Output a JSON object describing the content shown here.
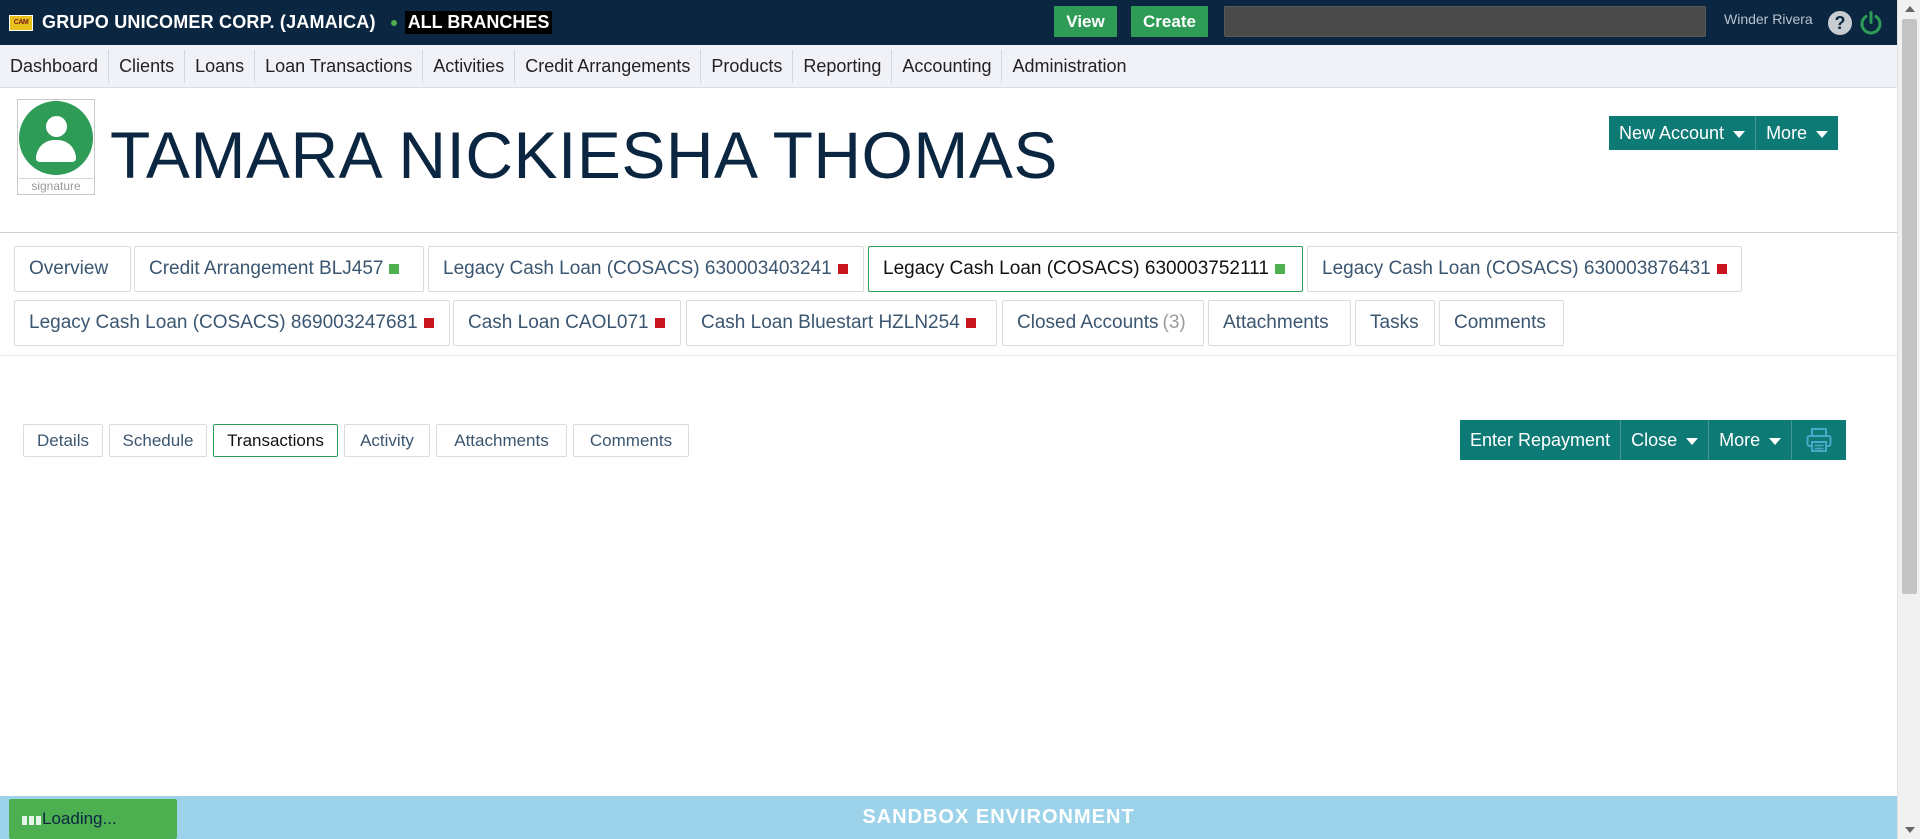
{
  "topbar": {
    "logo_text": "CAM",
    "org_name": "GRUPO UNICOMER CORP. (JAMAICA)",
    "branch": "ALL BRANCHES",
    "view_label": "View",
    "create_label": "Create",
    "search_placeholder": "",
    "username": "Winder Rivera",
    "help_icon": "?"
  },
  "nav": [
    {
      "label": "Dashboard"
    },
    {
      "label": "Clients"
    },
    {
      "label": "Loans"
    },
    {
      "label": "Loan  Transactions"
    },
    {
      "label": "Activities"
    },
    {
      "label": "Credit  Arrangements"
    },
    {
      "label": "Products"
    },
    {
      "label": "Reporting"
    },
    {
      "label": "Accounting"
    },
    {
      "label": "Administration"
    }
  ],
  "client": {
    "name": "TAMARA NICKIESHA THOMAS",
    "signature_label": "signature",
    "new_account_label": "New  Account",
    "more_label": "More"
  },
  "account_tabs": {
    "row1": [
      {
        "label": "Overview",
        "status": ""
      },
      {
        "label": "Credit Arrangement BLJ457",
        "status": "green"
      },
      {
        "label": "Legacy Cash Loan (COSACS) 630003403241",
        "status": "red"
      },
      {
        "label": "Legacy Cash Loan (COSACS) 630003752111",
        "status": "green",
        "active": true
      },
      {
        "label": "Legacy Cash Loan (COSACS) 630003876431",
        "status": "red"
      }
    ],
    "row2": [
      {
        "label": "Legacy Cash Loan (COSACS) 869003247681",
        "status": "red"
      },
      {
        "label": "Cash Loan CAOL071",
        "status": "red"
      },
      {
        "label": "Cash Loan Bluestart HZLN254",
        "status": "red"
      },
      {
        "label": "Closed Accounts",
        "count": "(3)"
      },
      {
        "label": "Attachments"
      },
      {
        "label": "Tasks"
      },
      {
        "label": "Comments"
      }
    ]
  },
  "sub_tabs": [
    {
      "label": "Details"
    },
    {
      "label": "Schedule"
    },
    {
      "label": "Transactions",
      "active": true
    },
    {
      "label": "Activity"
    },
    {
      "label": "Attachments"
    },
    {
      "label": "Comments"
    }
  ],
  "loan_actions": {
    "enter_repayment": "Enter  Repayment",
    "close": "Close",
    "more": "More",
    "print_icon": "printer-icon"
  },
  "footer": {
    "environment": "SANDBOX ENVIRONMENT",
    "loading": "Loading..."
  },
  "colors": {
    "topbar": "#0b2641",
    "accent_green": "#2e9c57",
    "teal": "#0e7a75",
    "status_red": "#c8141e",
    "status_green": "#4caf50",
    "footer": "#9dd3ea"
  }
}
